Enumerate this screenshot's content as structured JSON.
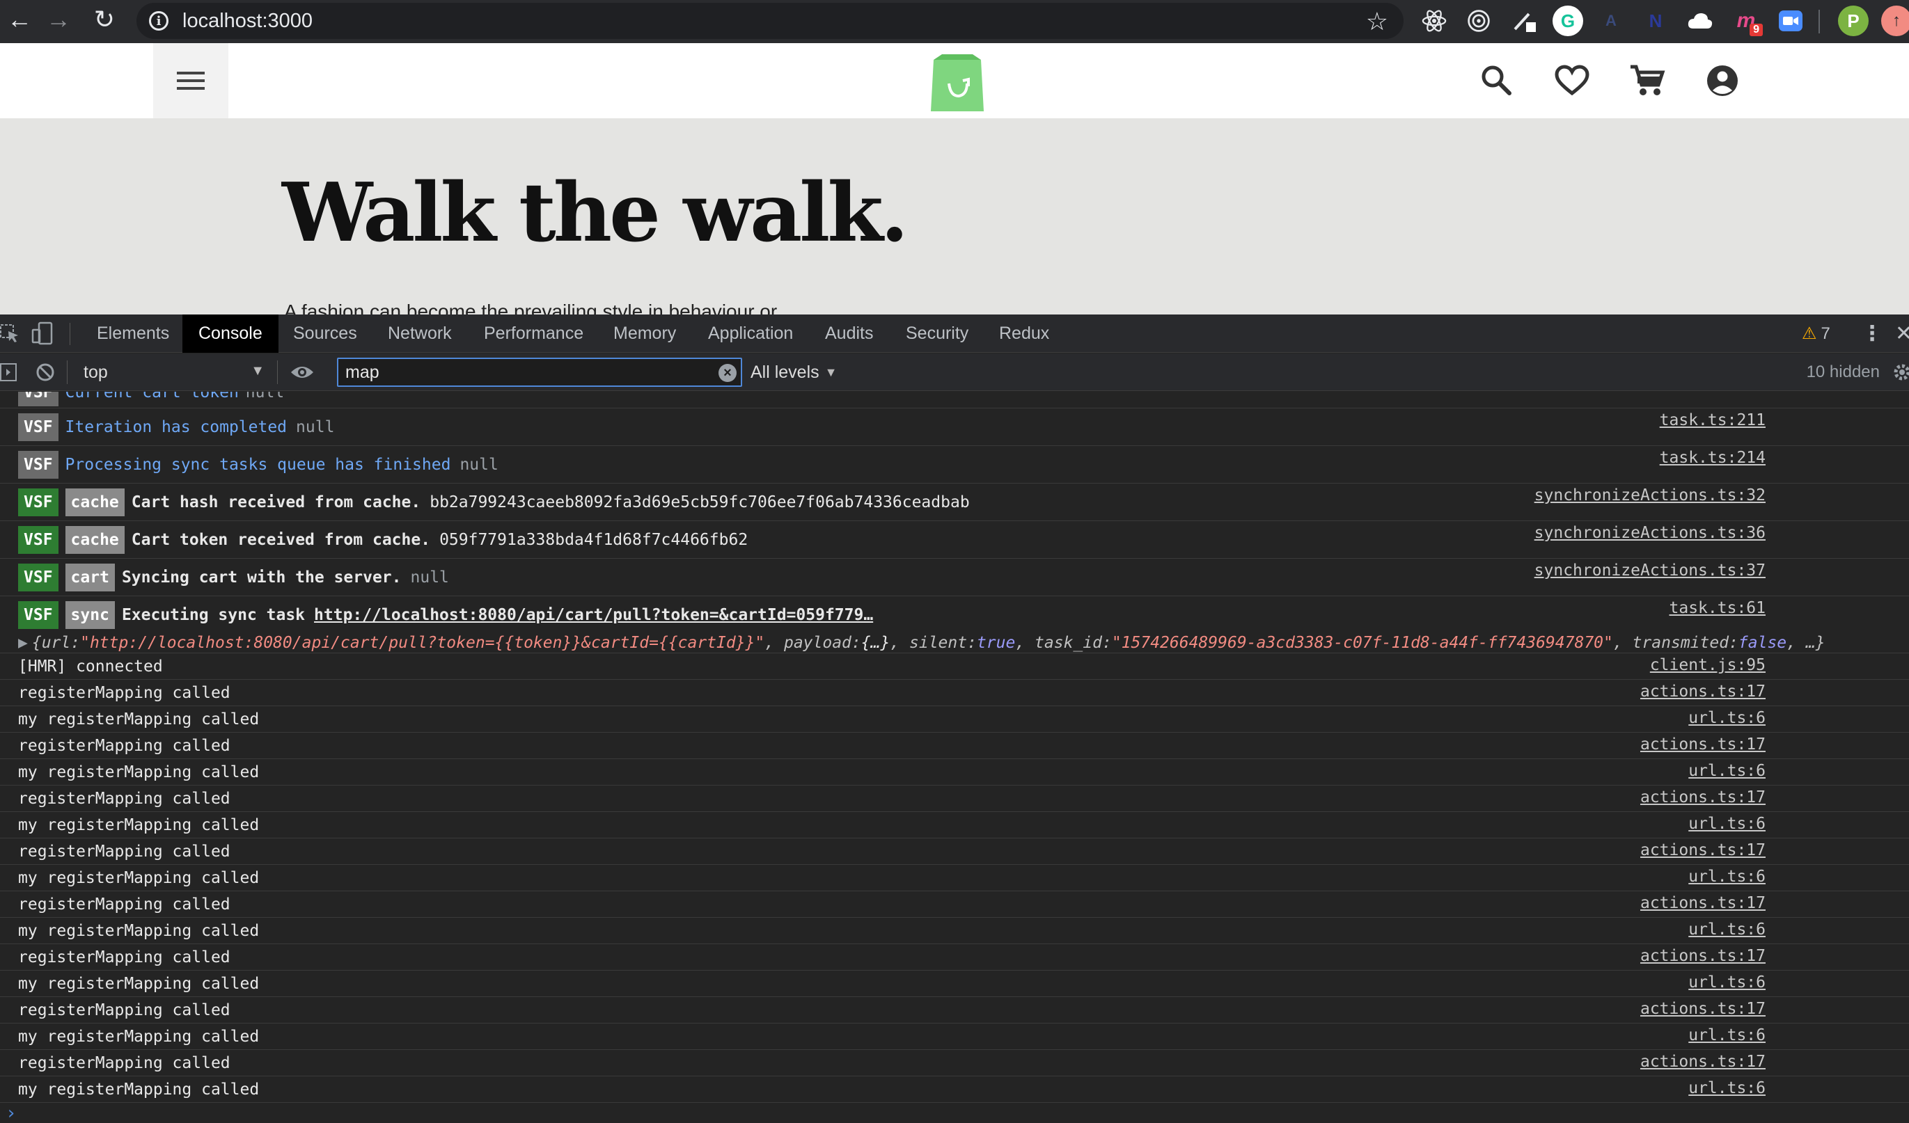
{
  "browser": {
    "url": "localhost:3000",
    "back_icon": "←",
    "forward_icon": "→",
    "reload_icon": "↻",
    "star_icon": "☆",
    "profile_initial": "P",
    "notification_count": "9",
    "extension_letter_n": "N",
    "extension_letter_a": "A",
    "extension_letter_m": "m",
    "extension_letter_g": "G"
  },
  "site": {
    "hero_title": "Walk the walk.",
    "hero_subtitle": "A fashion can become the prevailing style in behaviour or",
    "accent_color": "#7fd67f"
  },
  "devtools": {
    "tabs": [
      "Elements",
      "Console",
      "Sources",
      "Network",
      "Performance",
      "Memory",
      "Application",
      "Audits",
      "Security",
      "Redux"
    ],
    "active_tab": "Console",
    "warning_count": "7",
    "context": "top",
    "filter_value": "map",
    "levels_label": "All levels",
    "hidden_label": "10 hidden"
  },
  "console": {
    "partial_row": {
      "text": "Current cart token",
      "value": "null"
    },
    "vsf_rows": [
      {
        "badge": "VSF",
        "tag": "",
        "msg": "Iteration has completed",
        "value": "null",
        "source": "task.ts:211"
      },
      {
        "badge": "VSF",
        "tag": "",
        "msg": "Processing sync tasks queue has finished",
        "value": "null",
        "source": "task.ts:214"
      },
      {
        "badge": "VSF",
        "tag": "cache",
        "msg": "Cart hash received from cache.",
        "value": "bb2a799243caeeb8092fa3d69e5cb59fc706ee7f06ab74336ceadbab",
        "source": "synchronizeActions.ts:32"
      },
      {
        "badge": "VSF",
        "tag": "cache",
        "msg": "Cart token received from cache.",
        "value": "059f7791a338bda4f1d68f7c4466fb62",
        "source": "synchronizeActions.ts:36"
      },
      {
        "badge": "VSF",
        "tag": "cart",
        "msg": "Syncing cart with the server.",
        "value": "null",
        "source": "synchronizeActions.ts:37"
      },
      {
        "badge": "VSF",
        "tag": "sync",
        "msg": "Executing sync task",
        "value": "http://localhost:8080/api/cart/pull?token=&cartId=059f779…",
        "source": "task.ts:61"
      }
    ],
    "object_row": {
      "k_url": "url: ",
      "v_url": "\"http://localhost:8080/api/cart/pull?token={{token}}&cartId={{cartId}}\"",
      "k_payload": "payload: ",
      "v_payload": "{…}",
      "k_silent": "silent: ",
      "v_silent": "true",
      "k_task": "task_id: ",
      "v_task": "\"1574266489969-a3cd3383-c07f-11d8-a44f-ff7436947870\"",
      "k_trans": "transmited: ",
      "v_trans": "false",
      "tail": "…}"
    },
    "log_rows": [
      {
        "msg": "[HMR] connected",
        "source": "client.js:95"
      },
      {
        "msg": "registerMapping called",
        "source": "actions.ts:17"
      },
      {
        "msg": "my registerMapping called",
        "source": "url.ts:6"
      },
      {
        "msg": "registerMapping called",
        "source": "actions.ts:17"
      },
      {
        "msg": "my registerMapping called",
        "source": "url.ts:6"
      },
      {
        "msg": "registerMapping called",
        "source": "actions.ts:17"
      },
      {
        "msg": "my registerMapping called",
        "source": "url.ts:6"
      },
      {
        "msg": "registerMapping called",
        "source": "actions.ts:17"
      },
      {
        "msg": "my registerMapping called",
        "source": "url.ts:6"
      },
      {
        "msg": "registerMapping called",
        "source": "actions.ts:17"
      },
      {
        "msg": "my registerMapping called",
        "source": "url.ts:6"
      },
      {
        "msg": "registerMapping called",
        "source": "actions.ts:17"
      },
      {
        "msg": "my registerMapping called",
        "source": "url.ts:6"
      },
      {
        "msg": "registerMapping called",
        "source": "actions.ts:17"
      },
      {
        "msg": "my registerMapping called",
        "source": "url.ts:6"
      },
      {
        "msg": "registerMapping called",
        "source": "actions.ts:17"
      },
      {
        "msg": "my registerMapping called",
        "source": "url.ts:6"
      }
    ]
  }
}
